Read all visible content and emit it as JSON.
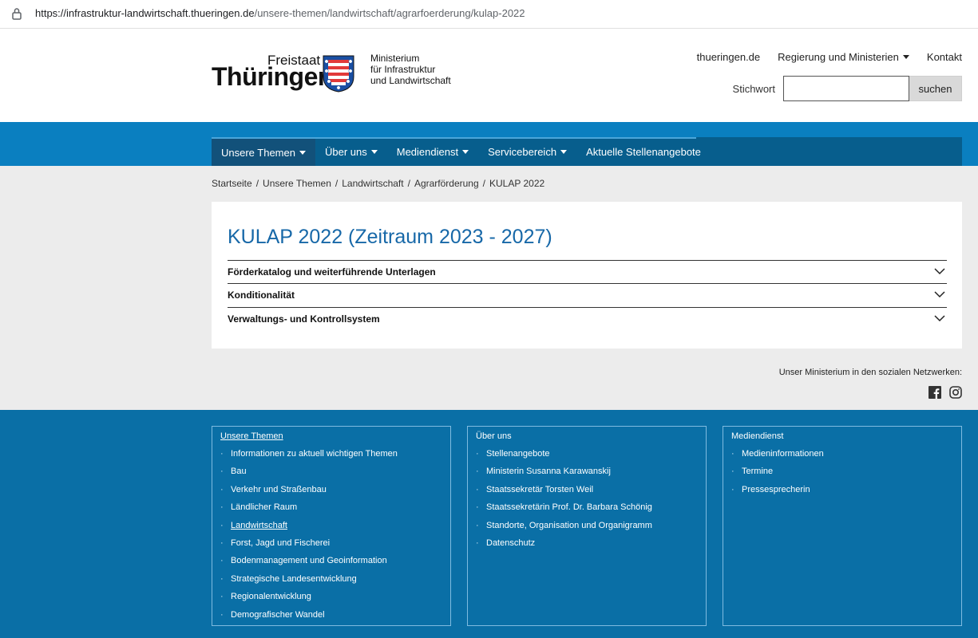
{
  "browser": {
    "url_host": "https://infrastruktur-landwirtschaft.thueringen.de",
    "url_path": "/unsere-themen/landwirtschaft/agrarfoerderung/kulap-2022"
  },
  "logo": {
    "freistaat": "Freistaat",
    "thueringen": "Thüringen",
    "ministry_line1": "Ministerium",
    "ministry_line2": "für Infrastruktur",
    "ministry_line3": "und Landwirtschaft"
  },
  "topnav": {
    "link1": "thueringen.de",
    "link2": "Regierung und Ministerien",
    "link3": "Kontakt"
  },
  "search": {
    "label": "Stichwort",
    "value": "",
    "button": "suchen"
  },
  "mainnav": {
    "items": [
      {
        "label": "Unsere Themen"
      },
      {
        "label": "Über uns"
      },
      {
        "label": "Mediendienst"
      },
      {
        "label": "Servicebereich"
      },
      {
        "label": "Aktuelle Stellenangebote"
      }
    ]
  },
  "breadcrumb": [
    "Startseite",
    "Unsere Themen",
    "Landwirtschaft",
    "Agrarförderung",
    "KULAP 2022"
  ],
  "content": {
    "title": "KULAP 2022 (Zeitraum 2023 - 2027)",
    "accordions": [
      {
        "label": "Förderkatalog und weiterführende Unterlagen"
      },
      {
        "label": "Konditionalität"
      },
      {
        "label": "Verwaltungs- und Kontrollsystem"
      }
    ]
  },
  "social": {
    "text": "Unser Ministerium in den sozialen Netzwerken:",
    "icons": [
      "facebook-icon",
      "instagram-icon"
    ]
  },
  "footer": {
    "col1": {
      "head": "Unsere Themen",
      "items": [
        "Informationen zu aktuell wichtigen Themen",
        "Bau",
        "Verkehr und Straßenbau",
        "Ländlicher Raum",
        "Landwirtschaft",
        "Forst, Jagd und Fischerei",
        "Bodenmanagement und Geoinformation",
        "Strategische Landesentwicklung",
        "Regionalentwicklung",
        "Demografischer Wandel"
      ]
    },
    "col2": {
      "head": "Über uns",
      "items": [
        "Stellenangebote",
        "Ministerin Susanna Karawanskij",
        "Staatssekretär Torsten Weil",
        "Staatssekretärin Prof. Dr. Barbara Schönig",
        "Standorte, Organisation und Organigramm",
        "Datenschutz"
      ]
    },
    "col3": {
      "head": "Mediendienst",
      "items": [
        "Medieninformationen",
        "Termine",
        "Pressesprecherin"
      ]
    }
  },
  "colors": {
    "nav_band": "#0a7fc0",
    "nav_bar": "#075e8d",
    "title_blue": "#1768a8",
    "footer": "#0a6fa6"
  }
}
